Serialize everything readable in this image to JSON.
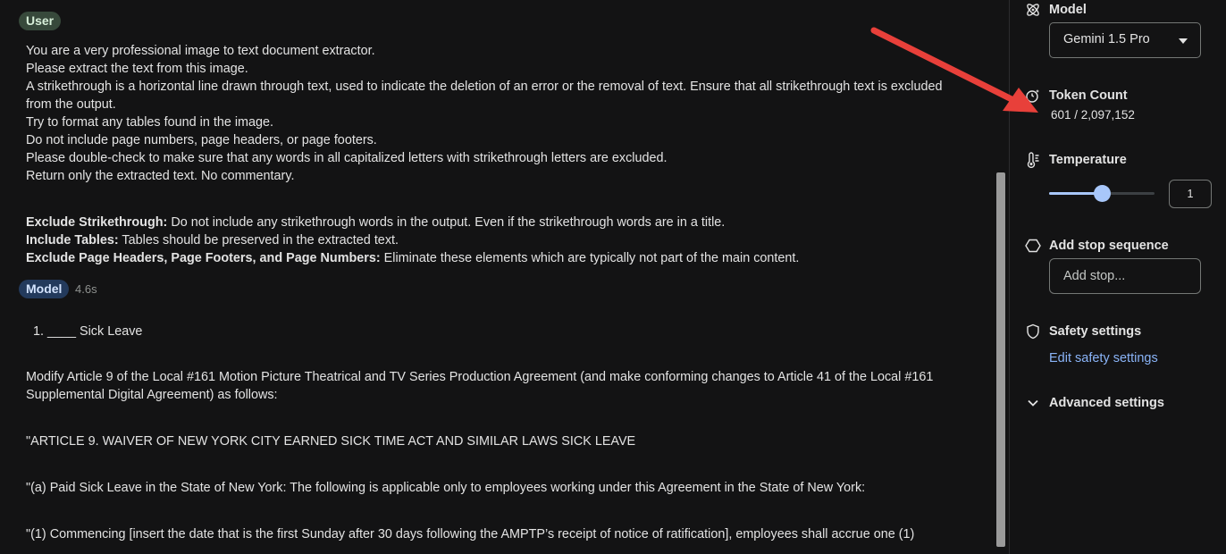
{
  "chat": {
    "user_chip": "User",
    "prompt_lines": [
      "You are a very professional image to text document extractor.",
      "Please extract the text from this image.",
      "A strikethrough is a horizontal line drawn through text, used to indicate the deletion of an error or the removal of text. Ensure that all strikethrough text is excluded",
      "from the output.",
      "Try to format any tables found in the image.",
      "Do not include page numbers, page headers, or page footers.",
      "Please double-check to make sure that any words in all capitalized letters with strikethrough letters are excluded.",
      "Return only the extracted text. No commentary."
    ],
    "rules": [
      {
        "label": "Exclude Strikethrough:",
        "text": " Do not include any strikethrough words in the output. Even if the strikethrough words are in a title."
      },
      {
        "label": "Include Tables:",
        "text": " Tables should be preserved in the extracted text."
      },
      {
        "label": "Exclude Page Headers, Page Footers, and Page Numbers:",
        "text": " Eliminate these elements which are typically not part of the main content."
      }
    ],
    "model_chip": "Model",
    "elapsed": "4.6s",
    "response": {
      "list_number": "1.",
      "list_item": "____ Sick Leave",
      "paragraphs": [
        "Modify Article 9 of the Local #161 Motion Picture Theatrical and TV Series Production Agreement (and make conforming changes to Article 41 of the Local #161",
        "Supplemental Digital Agreement) as follows:",
        "\"ARTICLE 9. WAIVER OF NEW YORK CITY EARNED SICK TIME ACT AND SIMILAR LAWS SICK LEAVE",
        "\"(a) Paid Sick Leave in the State of New York: The following is applicable only to employees working under this Agreement in the State of New York:",
        "\"(1) Commencing [insert the date that is the first Sunday after 30 days following the AMPTP’s receipt of notice of ratification], employees shall accrue one (1)"
      ]
    }
  },
  "settings": {
    "model": {
      "title": "Model",
      "selected": "Gemini 1.5 Pro",
      "icon": "model-icon"
    },
    "token_count": {
      "title": "Token Count",
      "value": "601 / 2,097,152",
      "icon": "token-count-icon"
    },
    "temperature": {
      "title": "Temperature",
      "value": "1",
      "level_fraction": 0.5,
      "icon": "thermometer-icon"
    },
    "stop_sequence": {
      "title": "Add stop sequence",
      "placeholder": "Add stop...",
      "icon": "hexagon-icon"
    },
    "safety": {
      "title": "Safety settings",
      "link": "Edit safety settings",
      "icon": "shield-icon"
    },
    "advanced": {
      "title": "Advanced settings",
      "icon": "chevron-down-icon"
    }
  },
  "colors": {
    "background": "#131314",
    "user_chip": "#37493b",
    "model_chip": "#233a5c",
    "accent": "#a8c7fa",
    "link": "#8ab4f8",
    "annotation_arrow": "#e8403a"
  }
}
